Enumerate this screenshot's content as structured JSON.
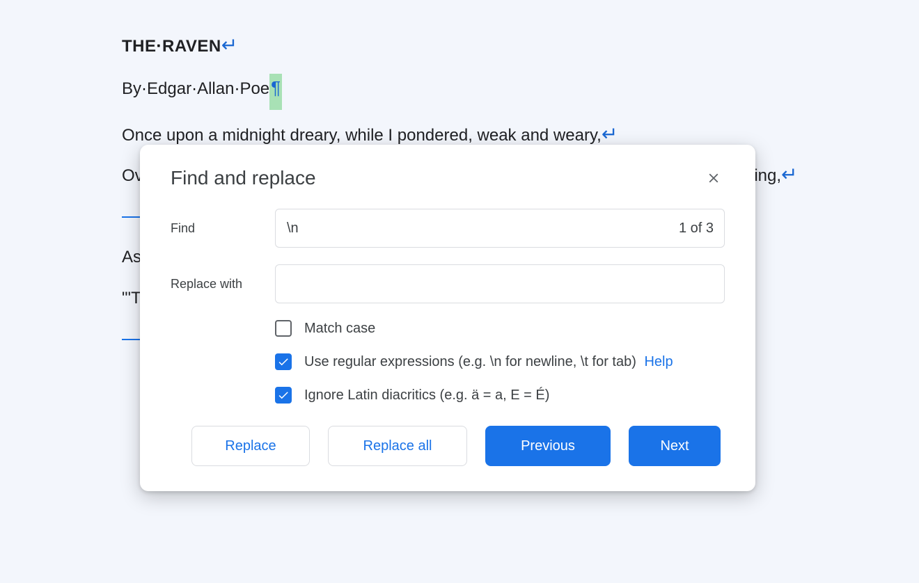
{
  "document": {
    "title_parts": [
      "THE",
      "RAVEN"
    ],
    "author_parts": [
      "By",
      "Edgar",
      "Allan",
      "Poe"
    ],
    "line2": "Once upon a midnight dreary, while I pondered, weak and weary,",
    "line3_left": "Ov",
    "line3_right": "ping,",
    "line4_left": "As",
    "line5_left": "\"'T"
  },
  "dialog": {
    "title": "Find and replace",
    "find_label": "Find",
    "find_value": "\\n",
    "find_count": "1 of 3",
    "replace_label": "Replace with",
    "replace_value": "",
    "options": {
      "match_case": {
        "label": "Match case",
        "checked": false
      },
      "regex": {
        "label": "Use regular expressions (e.g. \\n for newline, \\t for tab)",
        "checked": true,
        "help_text": "Help"
      },
      "diacritics": {
        "label": "Ignore Latin diacritics (e.g. ä = a, E = É)",
        "checked": true
      }
    },
    "buttons": {
      "replace": "Replace",
      "replace_all": "Replace all",
      "previous": "Previous",
      "next": "Next"
    }
  }
}
